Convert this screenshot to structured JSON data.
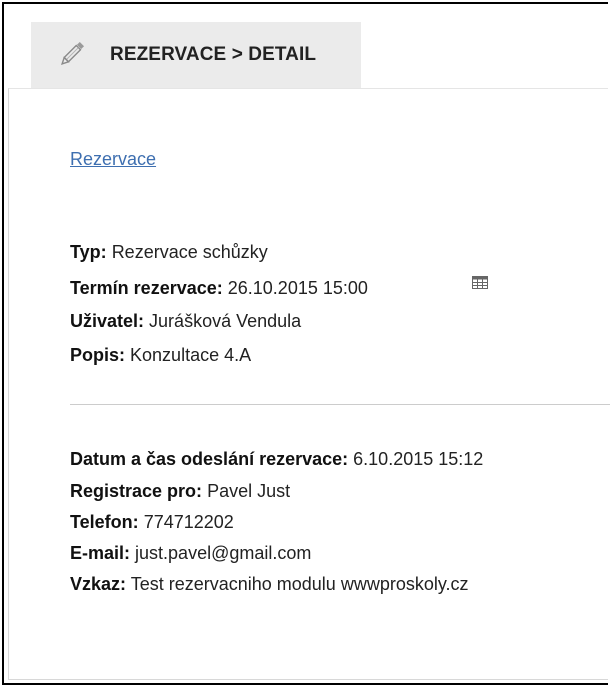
{
  "tab": {
    "title": "REZERVACE > DETAIL",
    "icon": "pencil-icon"
  },
  "breadcrumb_link": "Rezervace",
  "reservation": {
    "type_label": "Typ:",
    "type_value": "Rezervace schůzky",
    "term_label": "Termín rezervace:",
    "term_value": "26.10.2015 15:00",
    "term_icon": "calendar-icon",
    "user_label": "Uživatel:",
    "user_value": "Jurášková Vendula",
    "desc_label": "Popis:",
    "desc_value": "Konzultace 4.A"
  },
  "submission": {
    "sent_label": "Datum a čas odeslání rezervace:",
    "sent_value": "6.10.2015 15:12",
    "reg_label": "Registrace pro:",
    "reg_value": "Pavel Just",
    "phone_label": "Telefon:",
    "phone_value": "774712202",
    "email_label": "E-mail:",
    "email_value": "just.pavel@gmail.com",
    "msg_label": "Vzkaz:",
    "msg_value": "Test rezervacniho modulu wwwproskoly.cz"
  },
  "colors": {
    "link": "#3e6fb0",
    "tab_bg": "#ebebeb"
  }
}
